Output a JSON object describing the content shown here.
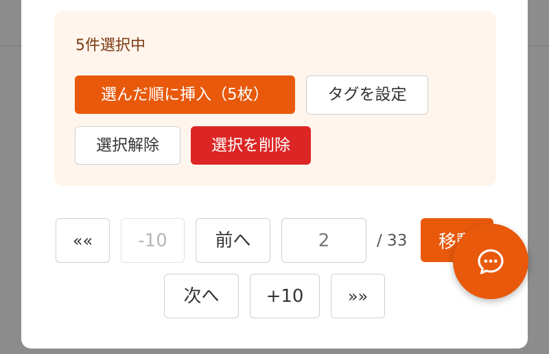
{
  "selection": {
    "count_text": "5件選択中",
    "insert_in_order_label": "選んだ順に挿入（5枚）",
    "set_tag_label": "タグを設定",
    "deselect_label": "選択解除",
    "delete_selected_label": "選択を削除"
  },
  "pagination": {
    "first_label": "««",
    "back10_label": "-10",
    "prev_label": "前へ",
    "page_input_placeholder": "2",
    "total_text": "/ 33",
    "go_label": "移動",
    "next_label": "次へ",
    "forward10_label": "+10",
    "last_label": "»»"
  },
  "chat_fab": {
    "icon": "chat-bubble-icon"
  },
  "colors": {
    "accent": "#e8590c",
    "danger": "#dc2626",
    "panel_bg": "#fff5ec"
  }
}
